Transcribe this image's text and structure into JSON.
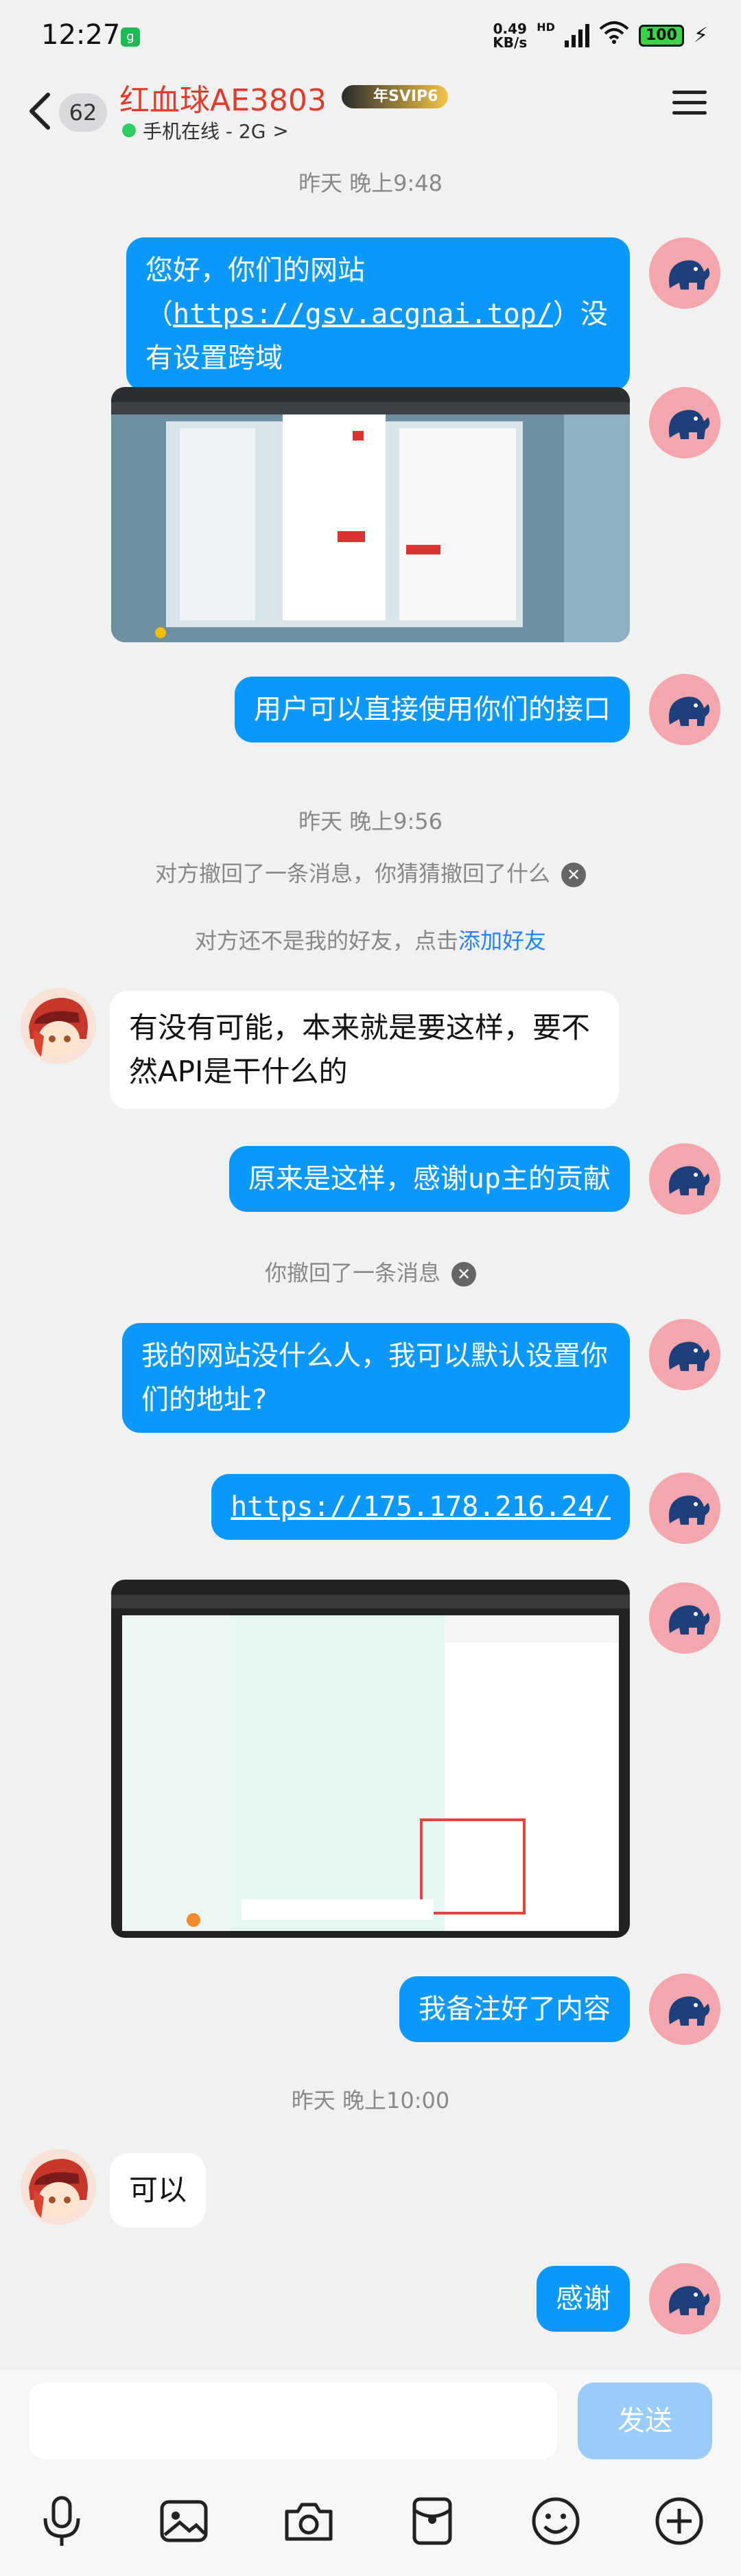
{
  "status_bar": {
    "time": "12:27",
    "app_icon": "g",
    "net_speed_value": "0.49",
    "net_speed_unit": "KB/s",
    "hd_label": "HD",
    "battery": "100"
  },
  "header": {
    "unread_count": "62",
    "contact_name": "红血球AE3803",
    "vip_badge": "年SVIP6",
    "online_status": "手机在线 - 2G",
    "online_chevron": ">"
  },
  "chat": {
    "ts1": "昨天 晚上9:48",
    "msg1_part1": "您好，你们的网站（",
    "msg1_link": "https://gsv.acgnai.top/",
    "msg1_part2": "）没有设置跨域",
    "msg3": "用户可以直接使用你们的接口",
    "ts2": "昨天 晚上9:56",
    "sys1": "对方撤回了一条消息，你猜猜撤回了什么",
    "sys2_text": "对方还不是我的好友，点击",
    "sys2_link": "添加好友",
    "reply1": "有没有可能，本来就是要这样，要不然API是干什么的",
    "msg4": "原来是这样，感谢up主的贡献",
    "sys3": "你撤回了一条消息",
    "msg5": "我的网站没什么人，我可以默认设置你们的地址?",
    "msg6_link": "https://175.178.216.24/",
    "msg8": "我备注好了内容",
    "ts3": "昨天 晚上10:00",
    "reply2": "可以",
    "msg9": "感谢"
  },
  "input_bar": {
    "placeholder": "",
    "send_label": "发送"
  },
  "icons": {
    "toolbar": [
      "microphone-icon",
      "image-icon",
      "camera-icon",
      "red-packet-icon",
      "emoji-icon",
      "plus-icon"
    ]
  },
  "colors": {
    "bubble_me": "#0a99fb",
    "bubble_other": "#ffffff",
    "contact_name": "#e03c2d",
    "link": "#2684f6",
    "send_disabled": "#99cdf7"
  }
}
